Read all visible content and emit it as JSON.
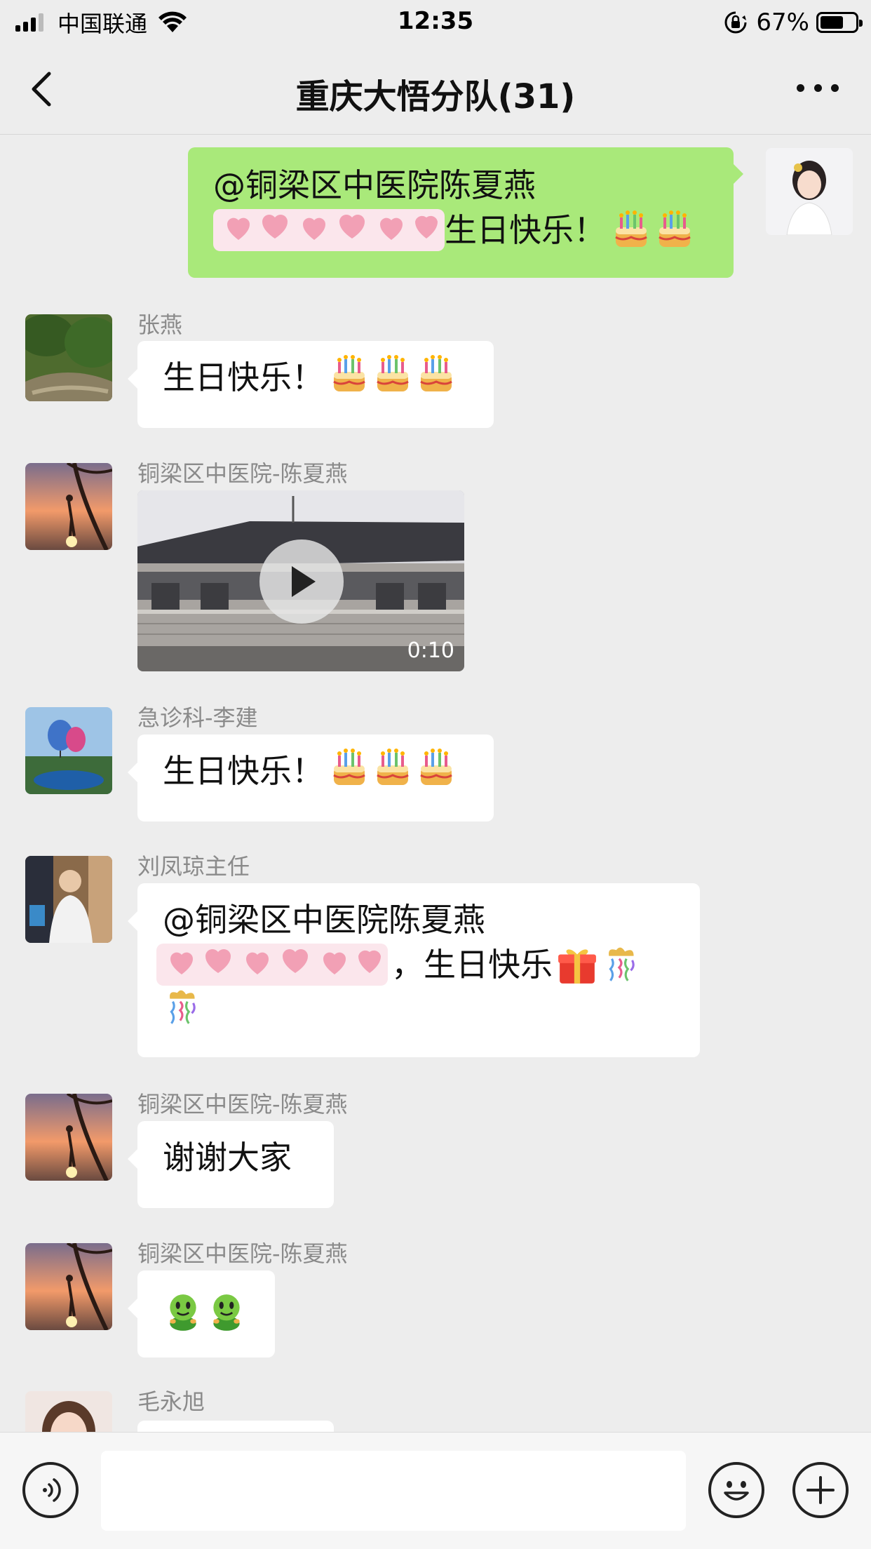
{
  "status_bar": {
    "carrier": "中国联通",
    "time": "12:35",
    "battery_percent": "67%",
    "battery_level": 0.67,
    "icons": [
      "cellular-signal-icon",
      "wifi-icon",
      "rotation-lock-icon",
      "battery-icon"
    ]
  },
  "nav": {
    "title": "重庆大悟分队(31)",
    "back_icon": "chevron-left-icon",
    "more_icon": "more-dots-icon"
  },
  "messages": [
    {
      "direction": "outgoing",
      "line1": "@铜梁区中医院陈夏燕",
      "line2_text": "生日快乐！",
      "emojis": [
        "cake",
        "cake"
      ],
      "redacted": "hearts"
    },
    {
      "direction": "incoming",
      "sender": "张燕",
      "text": "生日快乐！",
      "emojis": [
        "cake",
        "cake",
        "cake"
      ]
    },
    {
      "direction": "incoming",
      "sender": "铜梁区中医院-陈夏燕",
      "type": "video",
      "duration": "0:10"
    },
    {
      "direction": "incoming",
      "sender": "急诊科-李建",
      "text": "生日快乐！",
      "emojis": [
        "cake",
        "cake",
        "cake"
      ]
    },
    {
      "direction": "incoming",
      "sender": "刘凤琼主任",
      "line1": "@铜梁区中医院陈夏燕",
      "line2_text": "，生日快乐",
      "emojis": [
        "gift",
        "confetti",
        "confetti"
      ],
      "redacted": "hearts"
    },
    {
      "direction": "incoming",
      "sender": "铜梁区中医院-陈夏燕",
      "text": "谢谢大家"
    },
    {
      "direction": "incoming",
      "sender": "铜梁区中医院-陈夏燕",
      "emojis": [
        "green-man",
        "green-man"
      ]
    },
    {
      "direction": "incoming",
      "sender": "毛永旭",
      "text": ""
    }
  ],
  "input_bar": {
    "voice_icon": "voice-icon",
    "emoji_icon": "emoji-icon",
    "plus_icon": "plus-icon"
  },
  "colors": {
    "background": "#ededed",
    "outgoing_bubble": "#a9e97a",
    "incoming_bubble": "#ffffff",
    "sender_name": "#8a8a8a"
  }
}
